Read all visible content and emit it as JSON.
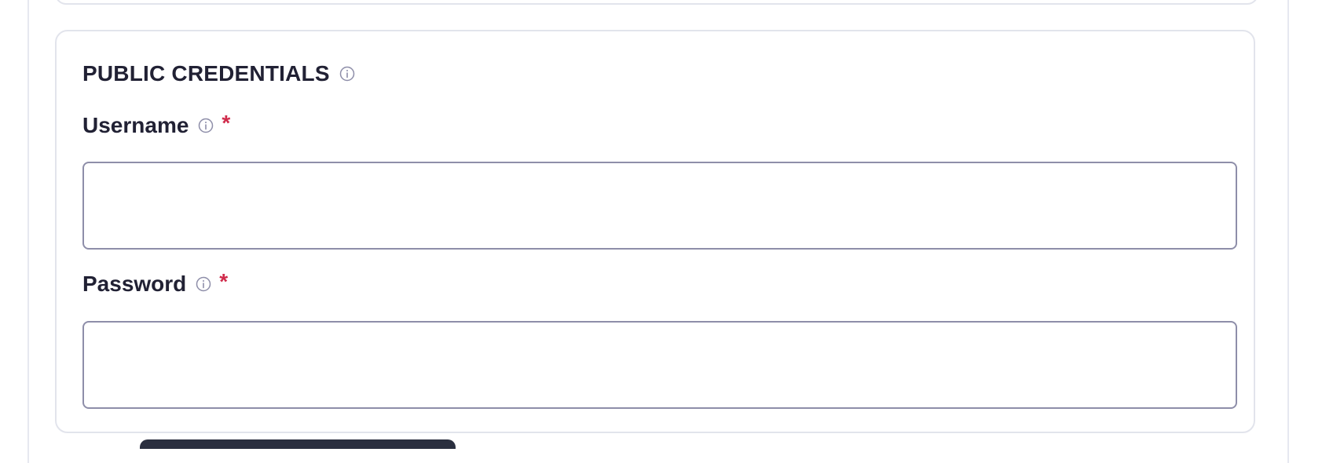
{
  "section": {
    "title": "PUBLIC CREDENTIALS",
    "info_icon": "info-circle-icon"
  },
  "fields": {
    "username": {
      "label": "Username",
      "required_mark": "*",
      "value": "",
      "placeholder": "",
      "info_icon": "info-circle-icon"
    },
    "password": {
      "label": "Password",
      "required_mark": "*",
      "value": "",
      "placeholder": "",
      "info_icon": "info-circle-icon"
    }
  },
  "colors": {
    "heading": "#212134",
    "required": "#d02b4b",
    "border": "#8e8ea9",
    "card_border": "#e2e4ec",
    "icon": "#8e8ea9"
  }
}
